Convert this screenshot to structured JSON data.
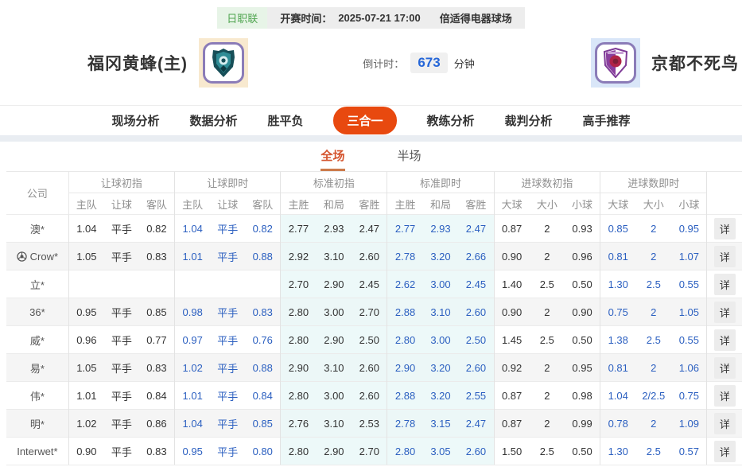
{
  "meta": {
    "league": "日职联",
    "kickoff_label": "开赛时间：",
    "kickoff_time": "2025-07-21 17:00",
    "venue": "倍适得电器球场"
  },
  "teams": {
    "home": {
      "name": "福冈黄蜂(主)"
    },
    "away": {
      "name": "京都不死鸟"
    }
  },
  "countdown": {
    "label": "倒计时：",
    "value": "673",
    "unit": "分钟"
  },
  "nav": {
    "tabs": [
      {
        "label": "现场分析",
        "active": false
      },
      {
        "label": "数据分析",
        "active": false
      },
      {
        "label": "胜平负",
        "active": false
      },
      {
        "label": "三合一",
        "active": true
      },
      {
        "label": "教练分析",
        "active": false
      },
      {
        "label": "裁判分析",
        "active": false
      },
      {
        "label": "高手推荐",
        "active": false
      }
    ]
  },
  "subtabs": [
    {
      "label": "全场",
      "active": true
    },
    {
      "label": "半场",
      "active": false
    }
  ],
  "odds_table": {
    "company_header": "公司",
    "detail_label": "详",
    "groups": [
      {
        "label": "让球初指",
        "cols": [
          "主队",
          "让球",
          "客队"
        ],
        "live": false,
        "tint": false
      },
      {
        "label": "让球即时",
        "cols": [
          "主队",
          "让球",
          "客队"
        ],
        "live": true,
        "tint": false
      },
      {
        "label": "标准初指",
        "cols": [
          "主胜",
          "和局",
          "客胜"
        ],
        "live": false,
        "tint": true
      },
      {
        "label": "标准即时",
        "cols": [
          "主胜",
          "和局",
          "客胜"
        ],
        "live": true,
        "tint": true
      },
      {
        "label": "进球数初指",
        "cols": [
          "大球",
          "大小",
          "小球"
        ],
        "live": false,
        "tint": false
      },
      {
        "label": "进球数即时",
        "cols": [
          "大球",
          "大小",
          "小球"
        ],
        "live": true,
        "tint": false
      }
    ],
    "rows": [
      {
        "company": "澳*",
        "ball_icon": false,
        "cells": [
          [
            "1.04",
            "平手",
            "0.82"
          ],
          [
            "1.04",
            "平手",
            "0.82"
          ],
          [
            "2.77",
            "2.93",
            "2.47"
          ],
          [
            "2.77",
            "2.93",
            "2.47"
          ],
          [
            "0.87",
            "2",
            "0.93"
          ],
          [
            "0.85",
            "2",
            "0.95"
          ]
        ]
      },
      {
        "company": "Crow*",
        "ball_icon": true,
        "cells": [
          [
            "1.05",
            "平手",
            "0.83"
          ],
          [
            "1.01",
            "平手",
            "0.88"
          ],
          [
            "2.92",
            "3.10",
            "2.60"
          ],
          [
            "2.78",
            "3.20",
            "2.66"
          ],
          [
            "0.90",
            "2",
            "0.96"
          ],
          [
            "0.81",
            "2",
            "1.07"
          ]
        ]
      },
      {
        "company": "立*",
        "ball_icon": false,
        "cells": [
          [
            "",
            "",
            ""
          ],
          [
            "",
            "",
            ""
          ],
          [
            "2.70",
            "2.90",
            "2.45"
          ],
          [
            "2.62",
            "3.00",
            "2.45"
          ],
          [
            "1.40",
            "2.5",
            "0.50"
          ],
          [
            "1.30",
            "2.5",
            "0.55"
          ]
        ]
      },
      {
        "company": "36*",
        "ball_icon": false,
        "cells": [
          [
            "0.95",
            "平手",
            "0.85"
          ],
          [
            "0.98",
            "平手",
            "0.83"
          ],
          [
            "2.80",
            "3.00",
            "2.70"
          ],
          [
            "2.88",
            "3.10",
            "2.60"
          ],
          [
            "0.90",
            "2",
            "0.90"
          ],
          [
            "0.75",
            "2",
            "1.05"
          ]
        ]
      },
      {
        "company": "威*",
        "ball_icon": false,
        "cells": [
          [
            "0.96",
            "平手",
            "0.77"
          ],
          [
            "0.97",
            "平手",
            "0.76"
          ],
          [
            "2.80",
            "2.90",
            "2.50"
          ],
          [
            "2.80",
            "3.00",
            "2.50"
          ],
          [
            "1.45",
            "2.5",
            "0.50"
          ],
          [
            "1.38",
            "2.5",
            "0.55"
          ]
        ]
      },
      {
        "company": "易*",
        "ball_icon": false,
        "cells": [
          [
            "1.05",
            "平手",
            "0.83"
          ],
          [
            "1.02",
            "平手",
            "0.88"
          ],
          [
            "2.90",
            "3.10",
            "2.60"
          ],
          [
            "2.90",
            "3.20",
            "2.60"
          ],
          [
            "0.92",
            "2",
            "0.95"
          ],
          [
            "0.81",
            "2",
            "1.06"
          ]
        ]
      },
      {
        "company": "伟*",
        "ball_icon": false,
        "cells": [
          [
            "1.01",
            "平手",
            "0.84"
          ],
          [
            "1.01",
            "平手",
            "0.84"
          ],
          [
            "2.80",
            "3.00",
            "2.60"
          ],
          [
            "2.88",
            "3.20",
            "2.55"
          ],
          [
            "0.87",
            "2",
            "0.98"
          ],
          [
            "1.04",
            "2/2.5",
            "0.75"
          ]
        ]
      },
      {
        "company": "明*",
        "ball_icon": false,
        "cells": [
          [
            "1.02",
            "平手",
            "0.86"
          ],
          [
            "1.04",
            "平手",
            "0.85"
          ],
          [
            "2.76",
            "3.10",
            "2.53"
          ],
          [
            "2.78",
            "3.15",
            "2.47"
          ],
          [
            "0.87",
            "2",
            "0.99"
          ],
          [
            "0.78",
            "2",
            "1.09"
          ]
        ]
      },
      {
        "company": "Interwet*",
        "ball_icon": false,
        "cells": [
          [
            "0.90",
            "平手",
            "0.83"
          ],
          [
            "0.95",
            "平手",
            "0.80"
          ],
          [
            "2.80",
            "2.90",
            "2.70"
          ],
          [
            "2.80",
            "3.05",
            "2.60"
          ],
          [
            "1.50",
            "2.5",
            "0.50"
          ],
          [
            "1.30",
            "2.5",
            "0.57"
          ]
        ]
      }
    ]
  },
  "colors": {
    "accent_orange": "#e8490f",
    "live_blue": "#2b5fc0",
    "countdown_blue": "#2566d8",
    "badge_green": "#4da34d",
    "tint_cyan": "#eaf7f7",
    "stripe_gray": "#f5f5f5"
  }
}
